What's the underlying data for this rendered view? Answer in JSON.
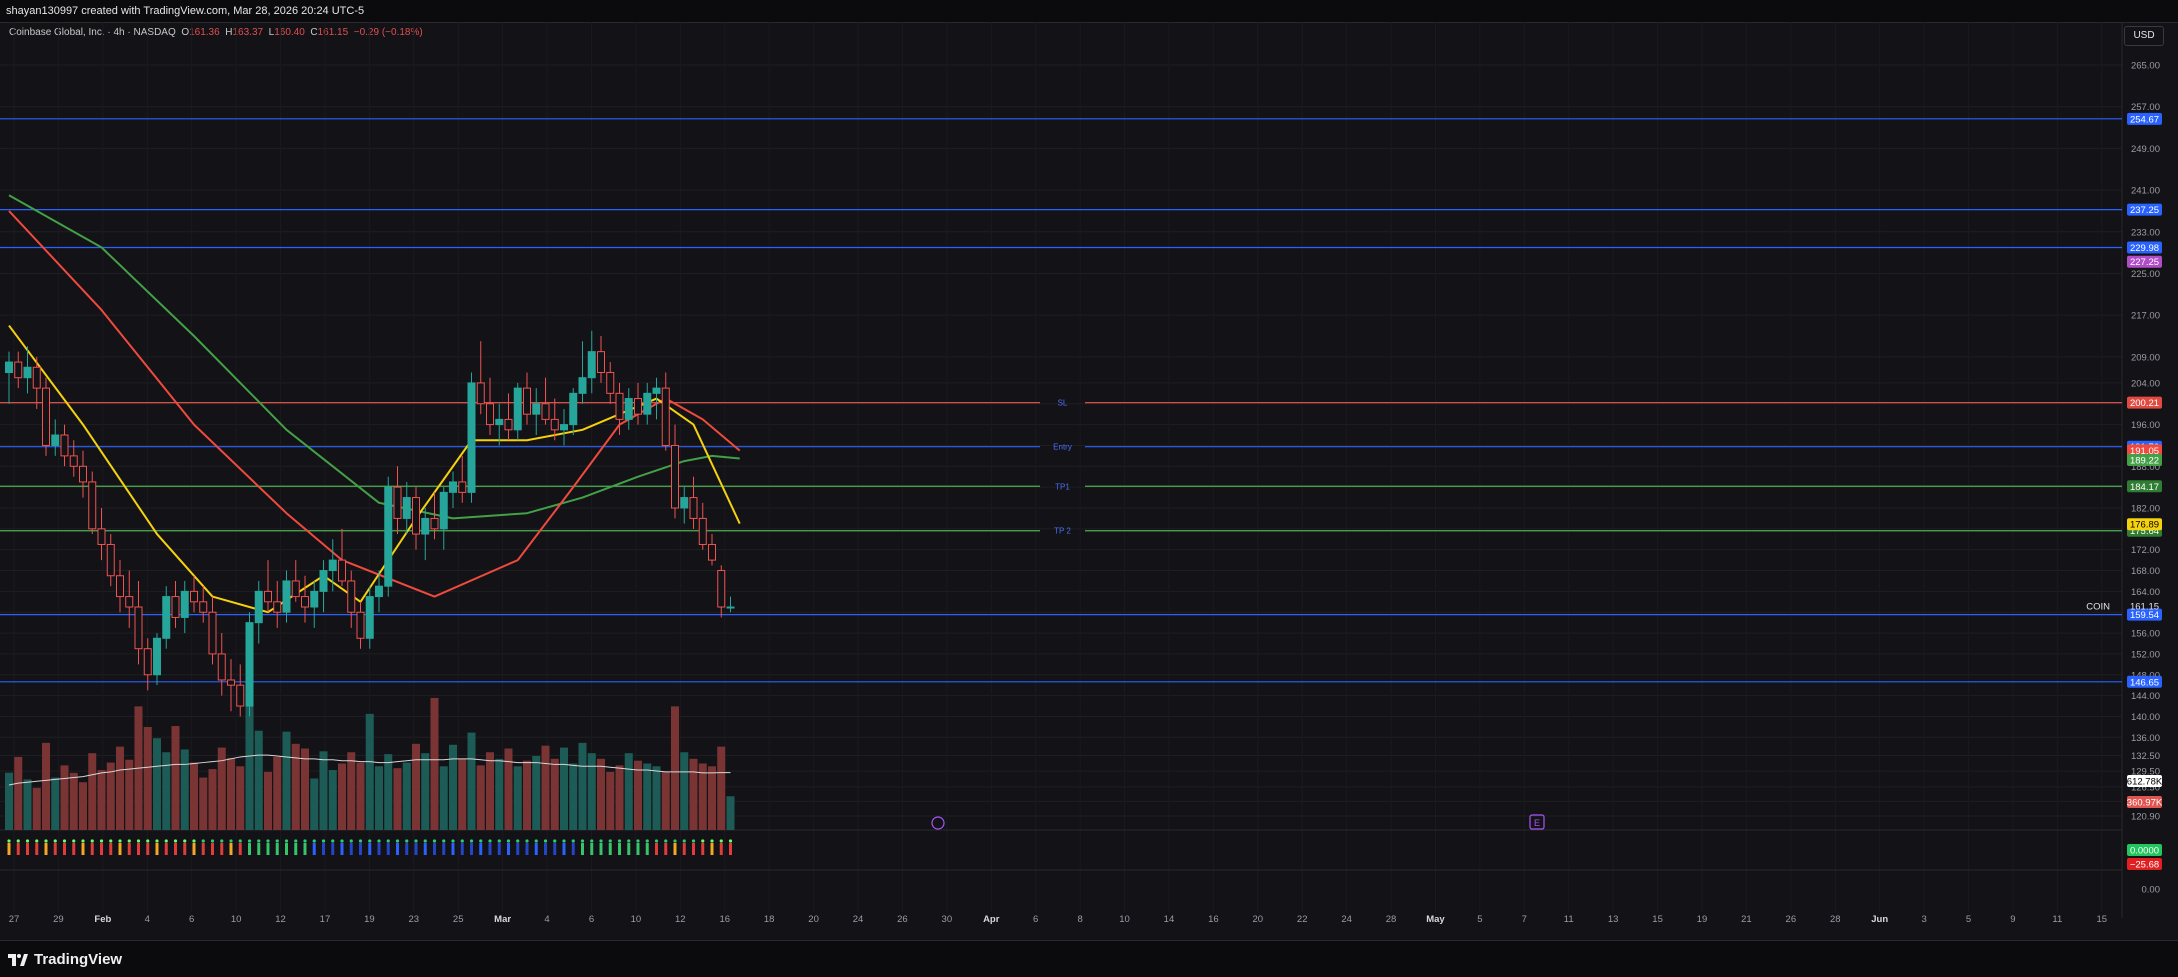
{
  "header": {
    "attribution": "shayan130997 created with TradingView.com, Mar 28, 2026 20:24 UTC-5"
  },
  "legend": {
    "symbol": "Coinbase Global, Inc. · 4h · NASDAQ",
    "o_label": "O",
    "o": "161.36",
    "h_label": "H",
    "h": "163.37",
    "l_label": "L",
    "l": "160.40",
    "c_label": "C",
    "c": "161.15",
    "change": "−0.29 (−0.18%)"
  },
  "currency": "USD",
  "brand": "TradingView",
  "symbol_tag": "COIN",
  "colors": {
    "background": "#131217",
    "up": "#26a69a",
    "down": "#ef5350",
    "blue_line": "#2962ff",
    "red_line": "#f05a4f",
    "green_line": "#4caf50",
    "purple_ma": "#b04cc8",
    "yellow_ma": "#f5d20c",
    "red_ma": "#f04a3e",
    "green_ma": "#43a047"
  },
  "chart_data": {
    "type": "candlestick",
    "timeframe": "4h",
    "x_ticks": [
      "27",
      "29",
      "Feb",
      "4",
      "6",
      "10",
      "12",
      "17",
      "19",
      "23",
      "25",
      "Mar",
      "4",
      "6",
      "10",
      "12",
      "16",
      "18",
      "20",
      "24",
      "26",
      "30",
      "Apr",
      "6",
      "8",
      "10",
      "14",
      "16",
      "20",
      "22",
      "24",
      "28",
      "May",
      "5",
      "7",
      "11",
      "13",
      "15",
      "19",
      "21",
      "26",
      "28",
      "Jun",
      "3",
      "5",
      "9",
      "11",
      "15"
    ],
    "x_tick_months": [
      "Feb",
      "Mar",
      "Apr",
      "May",
      "Jun"
    ],
    "y_ticks": [
      265.0,
      257.0,
      249.0,
      241.0,
      233.0,
      225.0,
      217.0,
      209.0,
      204.0,
      200.0,
      196.0,
      192.0,
      188.0,
      184.0,
      180.0,
      176.0,
      172.0,
      168.0,
      164.0,
      160.0,
      156.0,
      152.0,
      148.0,
      144.0,
      140.0,
      136.0,
      132.5,
      129.5,
      126.5,
      123.7,
      120.9
    ],
    "y_tick_labels": [
      "265.00",
      "257.00",
      "249.00",
      "241.00",
      "233.00",
      "225.00",
      "217.00",
      "209.00",
      "204.00",
      "200.00",
      "196.00",
      "192.00",
      "188.00",
      "184.00",
      "182.00",
      "176.00",
      "172.00",
      "168.00",
      "164.00",
      "160.00",
      "156.00",
      "152.00",
      "148.00",
      "144.00",
      "140.00",
      "136.00",
      "132.50",
      "129.50",
      "126.50",
      "123.70",
      "120.90"
    ],
    "horizontal_levels": [
      {
        "label": "",
        "value": 254.67,
        "color": "#2962ff",
        "tag": "254.67"
      },
      {
        "label": "",
        "value": 237.25,
        "color": "#2962ff",
        "tag": "237.25"
      },
      {
        "label": "",
        "value": 229.98,
        "color": "#2962ff",
        "tag": "229.98"
      },
      {
        "label": "SL",
        "value": 200.21,
        "color": "#f05a4f",
        "tag": "200.21"
      },
      {
        "label": "Entry",
        "value": 191.76,
        "color": "#2962ff",
        "tag": "191.76"
      },
      {
        "label": "TP1",
        "value": 184.17,
        "color": "#4caf50",
        "tag": "184.17"
      },
      {
        "label": "TP 2",
        "value": 175.64,
        "color": "#4caf50",
        "tag": "175.64"
      },
      {
        "label": "",
        "value": 159.54,
        "color": "#2962ff",
        "tag": "159.54"
      },
      {
        "label": "",
        "value": 146.65,
        "color": "#2962ff",
        "tag": "146.65"
      }
    ],
    "ma_tags": [
      {
        "value": 227.25,
        "color": "#b04cc8",
        "tag": "227.25"
      },
      {
        "value": 191.05,
        "color": "#f04a3e",
        "tag": "191.05"
      },
      {
        "value": 189.22,
        "color": "#43a047",
        "tag": "189.22"
      },
      {
        "value": 176.89,
        "color": "#f5d20c",
        "tag": "176.89"
      }
    ],
    "last_price": {
      "value": 161.15,
      "tag": "161.15"
    },
    "ohlc": [
      [
        206,
        210,
        200,
        208
      ],
      [
        208,
        210,
        203,
        205
      ],
      [
        205,
        211,
        202,
        207
      ],
      [
        207,
        209,
        199,
        203
      ],
      [
        203,
        205,
        190,
        192
      ],
      [
        192,
        197,
        190,
        194
      ],
      [
        194,
        196,
        188,
        190
      ],
      [
        190,
        193,
        186,
        188
      ],
      [
        188,
        191,
        182,
        185
      ],
      [
        185,
        187,
        175,
        176
      ],
      [
        176,
        180,
        170,
        173
      ],
      [
        173,
        175,
        165,
        167
      ],
      [
        167,
        170,
        160,
        163
      ],
      [
        163,
        168,
        157,
        161
      ],
      [
        161,
        166,
        150,
        153
      ],
      [
        153,
        155,
        145,
        148
      ],
      [
        148,
        156,
        146,
        155
      ],
      [
        155,
        165,
        153,
        163
      ],
      [
        163,
        166,
        157,
        159
      ],
      [
        159,
        166,
        156,
        164
      ],
      [
        164,
        167,
        160,
        162
      ],
      [
        162,
        165,
        158,
        160
      ],
      [
        160,
        163,
        150,
        152
      ],
      [
        152,
        156,
        144,
        147
      ],
      [
        147,
        151,
        141,
        146
      ],
      [
        146,
        150,
        140,
        142
      ],
      [
        142,
        160,
        140,
        158
      ],
      [
        158,
        166,
        154,
        164
      ],
      [
        164,
        170,
        160,
        162
      ],
      [
        162,
        166,
        157,
        160
      ],
      [
        160,
        168,
        158,
        166
      ],
      [
        166,
        170,
        162,
        163
      ],
      [
        163,
        167,
        158,
        161
      ],
      [
        161,
        166,
        157,
        164
      ],
      [
        164,
        170,
        160,
        168
      ],
      [
        168,
        174,
        164,
        170
      ],
      [
        170,
        176,
        165,
        166
      ],
      [
        166,
        168,
        157,
        160
      ],
      [
        160,
        162,
        153,
        155
      ],
      [
        155,
        165,
        153,
        163
      ],
      [
        163,
        168,
        160,
        165
      ],
      [
        165,
        186,
        163,
        184
      ],
      [
        184,
        188,
        175,
        178
      ],
      [
        178,
        185,
        175,
        182
      ],
      [
        182,
        184,
        172,
        175
      ],
      [
        175,
        180,
        170,
        178
      ],
      [
        178,
        183,
        174,
        176
      ],
      [
        176,
        184,
        172,
        183
      ],
      [
        183,
        187,
        180,
        185
      ],
      [
        185,
        190,
        181,
        183
      ],
      [
        183,
        206,
        181,
        204
      ],
      [
        204,
        212,
        198,
        200
      ],
      [
        200,
        205,
        194,
        196
      ],
      [
        196,
        200,
        192,
        197
      ],
      [
        197,
        202,
        193,
        195
      ],
      [
        195,
        204,
        193,
        203
      ],
      [
        203,
        206,
        196,
        198
      ],
      [
        198,
        203,
        194,
        200
      ],
      [
        200,
        205,
        196,
        197
      ],
      [
        197,
        201,
        193,
        195
      ],
      [
        195,
        199,
        192,
        196
      ],
      [
        196,
        203,
        194,
        202
      ],
      [
        202,
        212,
        200,
        205
      ],
      [
        205,
        214,
        202,
        210
      ],
      [
        210,
        213,
        204,
        206
      ],
      [
        206,
        208,
        200,
        202
      ],
      [
        202,
        204,
        194,
        197
      ],
      [
        197,
        203,
        195,
        201
      ],
      [
        201,
        204,
        196,
        198
      ],
      [
        198,
        204,
        196,
        202
      ],
      [
        202,
        205,
        197,
        203
      ],
      [
        203,
        206,
        191,
        192
      ],
      [
        192,
        196,
        178,
        180
      ],
      [
        180,
        184,
        177,
        182
      ],
      [
        182,
        186,
        176,
        178
      ],
      [
        178,
        181,
        172,
        173
      ],
      [
        173,
        175,
        169,
        170
      ],
      [
        168,
        169,
        159,
        161
      ],
      [
        161,
        163,
        160,
        161
      ]
    ],
    "volume": [
      612,
      780,
      540,
      450,
      930,
      560,
      690,
      610,
      510,
      820,
      640,
      720,
      890,
      750,
      1320,
      1100,
      980,
      830,
      1110,
      860,
      720,
      560,
      650,
      880,
      770,
      680,
      1390,
      1060,
      620,
      780,
      1050,
      920,
      870,
      550,
      840,
      640,
      710,
      830,
      720,
      1240,
      680,
      810,
      660,
      720,
      920,
      820,
      1410,
      680,
      910,
      760,
      1040,
      690,
      830,
      760,
      870,
      680,
      740,
      790,
      900,
      760,
      880,
      710,
      930,
      820,
      760,
      620,
      690,
      820,
      740,
      710,
      680,
      620,
      1320,
      830,
      760,
      710,
      680,
      890,
      360
    ],
    "volume_ma": [
      480,
      500,
      510,
      520,
      530,
      540,
      550,
      560,
      570,
      590,
      610,
      620,
      640,
      650,
      660,
      670,
      680,
      690,
      700,
      700,
      710,
      720,
      730,
      740,
      760,
      780,
      790,
      800,
      800,
      790,
      780,
      770,
      760,
      760,
      750,
      750,
      740,
      740,
      730,
      730,
      720,
      720,
      730,
      740,
      750,
      750,
      750,
      750,
      760,
      760,
      760,
      750,
      740,
      740,
      730,
      720,
      720,
      720,
      710,
      700,
      700,
      690,
      680,
      680,
      680,
      670,
      660,
      650,
      640,
      640,
      630,
      620,
      620,
      620,
      620,
      610,
      610,
      612,
      612
    ],
    "volume_tags": [
      "612.78K",
      "360.97K"
    ],
    "oscillator_tags": [
      "0.0000",
      "−25.68"
    ],
    "oscillator_y_label": "0.00",
    "ma_purple": [
      [
        0,
        294
      ],
      [
        20,
        290
      ],
      [
        40,
        285
      ],
      [
        60,
        279
      ],
      [
        79,
        274
      ]
    ],
    "ma_red": [
      [
        0,
        237
      ],
      [
        10,
        218
      ],
      [
        20,
        196
      ],
      [
        30,
        179
      ],
      [
        36,
        170
      ],
      [
        46,
        163
      ],
      [
        55,
        170
      ],
      [
        61,
        184
      ],
      [
        66,
        196
      ],
      [
        71,
        201
      ],
      [
        75,
        197
      ],
      [
        79,
        191
      ]
    ],
    "ma_green": [
      [
        0,
        240
      ],
      [
        10,
        230
      ],
      [
        20,
        213
      ],
      [
        30,
        195
      ],
      [
        40,
        181
      ],
      [
        48,
        178
      ],
      [
        56,
        179
      ],
      [
        62,
        182
      ],
      [
        68,
        186
      ],
      [
        73,
        189
      ],
      [
        76,
        190
      ],
      [
        79,
        189.5
      ]
    ],
    "ma_yellow": [
      [
        0,
        215
      ],
      [
        8,
        196
      ],
      [
        16,
        175
      ],
      [
        22,
        163
      ],
      [
        28,
        160
      ],
      [
        34,
        167
      ],
      [
        38,
        162
      ],
      [
        44,
        178
      ],
      [
        50,
        193
      ],
      [
        56,
        193
      ],
      [
        62,
        195
      ],
      [
        70,
        201
      ],
      [
        74,
        196
      ],
      [
        79,
        177
      ]
    ]
  }
}
